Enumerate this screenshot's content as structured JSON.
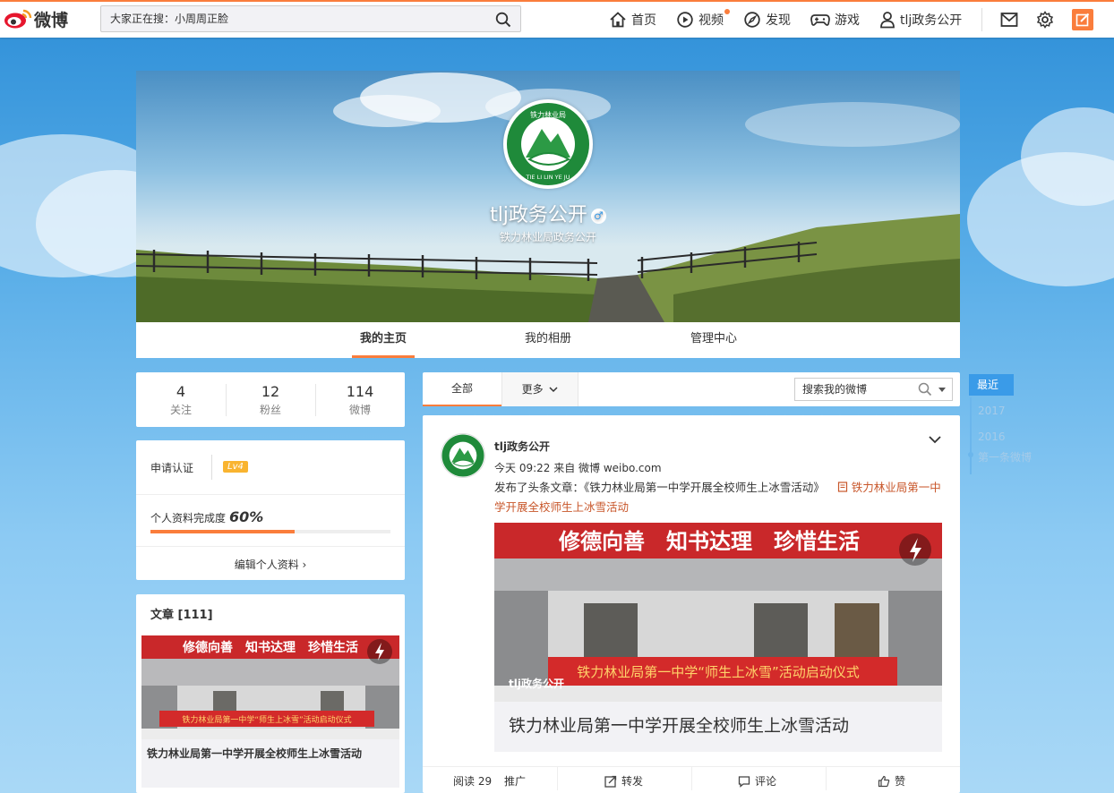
{
  "brand": {
    "name": "微博"
  },
  "search": {
    "placeholder": "大家正在搜：小周周正脸"
  },
  "nav": {
    "home": "首页",
    "video": "视频",
    "discover": "发现",
    "game": "游戏",
    "user": "tlj政务公开"
  },
  "profile": {
    "name": "tlj政务公开",
    "description": "铁力林业局政务公开",
    "gender_symbol": "♂",
    "logo_text_top": "铁力林业局",
    "logo_text_bottom": "TIE LI LIN YE JU"
  },
  "tabs": [
    "我的主页",
    "我的相册",
    "管理中心"
  ],
  "counts": [
    {
      "num": "4",
      "label": "关注"
    },
    {
      "num": "12",
      "label": "粉丝"
    },
    {
      "num": "114",
      "label": "微博"
    }
  ],
  "verify": {
    "label": "申请认证",
    "level": "Lv4"
  },
  "completion": {
    "label": "个人资料完成度",
    "value": "60%",
    "percent": 60
  },
  "edit_profile": "编辑个人资料 ›",
  "articles": {
    "title": "文章 [111]",
    "caption": "铁力林业局第一中学开展全校师生上冰雪活动"
  },
  "feed_filter": {
    "all": "全部",
    "more": "更多",
    "search_placeholder": "搜索我的微博"
  },
  "post": {
    "author": "tlj政务公开",
    "meta": "今天 09:22 来自 微博 weibo.com",
    "text_prefix": "发布了头条文章：《铁力林业局第一中学开展全校师生上冰雪活动》",
    "link_text": "铁力林业局第一中学开展全校师生上冰雪活动",
    "image_watermark": "tlj政务公开",
    "card_title": "铁力林业局第一中学开展全校师生上冰雪活动",
    "banner_top": "修德向善　知书达理　珍惜生活",
    "banner_bottom": "铁力林业局第一中学“师生上冰雪”活动启动仪式",
    "reads": "阅读 29",
    "promote": "推广",
    "forward": "转发",
    "comment": "评论",
    "like": "赞"
  },
  "timeline": {
    "current": "最近",
    "years": [
      "2017",
      "2016"
    ],
    "first": "第一条微博"
  },
  "colors": {
    "accent": "#fa7d3c",
    "link": "#c8562a",
    "timeline": "#3a9be8"
  }
}
